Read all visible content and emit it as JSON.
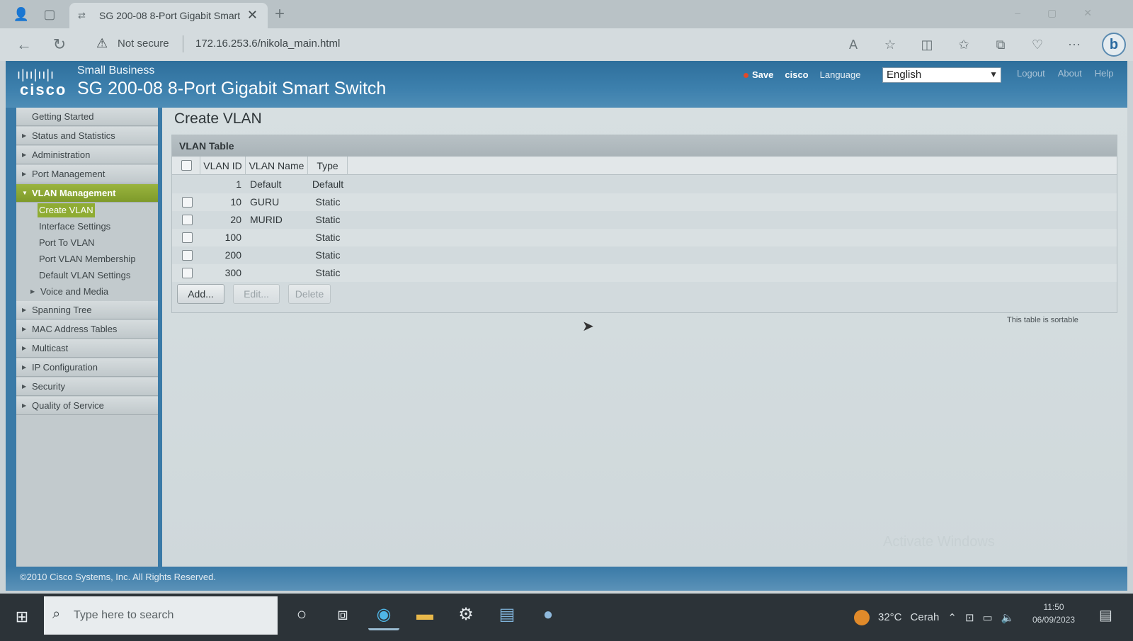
{
  "browser": {
    "tab_title": "SG 200-08 8-Port Gigabit Smart",
    "new_tab": "+",
    "close": "✕",
    "not_secure": "Not secure",
    "url": "172.16.253.6/nikola_main.html"
  },
  "header": {
    "small_business": "Small Business",
    "logo_word": "cisco",
    "product": "SG 200-08 8-Port Gigabit Smart Switch",
    "save": "Save",
    "user": "cisco",
    "language_label": "Language",
    "language_value": "English",
    "logout": "Logout",
    "about": "About",
    "help": "Help"
  },
  "sidebar": {
    "items": [
      {
        "label": "Getting Started"
      },
      {
        "label": "Status and Statistics"
      },
      {
        "label": "Administration"
      },
      {
        "label": "Port Management"
      },
      {
        "label": "VLAN Management"
      },
      {
        "label": "Spanning Tree"
      },
      {
        "label": "MAC Address Tables"
      },
      {
        "label": "Multicast"
      },
      {
        "label": "IP Configuration"
      },
      {
        "label": "Security"
      },
      {
        "label": "Quality of Service"
      }
    ],
    "vlan_sub": [
      {
        "label": "Create VLAN"
      },
      {
        "label": "Interface Settings"
      },
      {
        "label": "Port To VLAN"
      },
      {
        "label": "Port VLAN Membership"
      },
      {
        "label": "Default VLAN Settings"
      },
      {
        "label": "Voice and Media"
      }
    ]
  },
  "main": {
    "page_title": "Create VLAN",
    "table_title": "VLAN Table",
    "columns": [
      "VLAN ID",
      "VLAN Name",
      "Type"
    ],
    "rows": [
      {
        "id": "1",
        "name": "Default",
        "type": "Default"
      },
      {
        "id": "10",
        "name": "GURU",
        "type": "Static"
      },
      {
        "id": "20",
        "name": "MURID",
        "type": "Static"
      },
      {
        "id": "100",
        "name": "",
        "type": "Static"
      },
      {
        "id": "200",
        "name": "",
        "type": "Static"
      },
      {
        "id": "300",
        "name": "",
        "type": "Static"
      }
    ],
    "buttons": {
      "add": "Add...",
      "edit": "Edit...",
      "delete": "Delete"
    },
    "sortable_note": "This table is sortable",
    "watermark": "Activate Windows"
  },
  "footer": {
    "copyright": "©2010 Cisco Systems, Inc. All Rights Reserved."
  },
  "taskbar": {
    "search_placeholder": "Type here to search",
    "temperature": "32°C",
    "weather": "Cerah",
    "time": "11:50",
    "date": "06/09/2023"
  },
  "colors": {
    "cisco_blue": "#3a7aa7",
    "active_green": "#8fac33"
  }
}
